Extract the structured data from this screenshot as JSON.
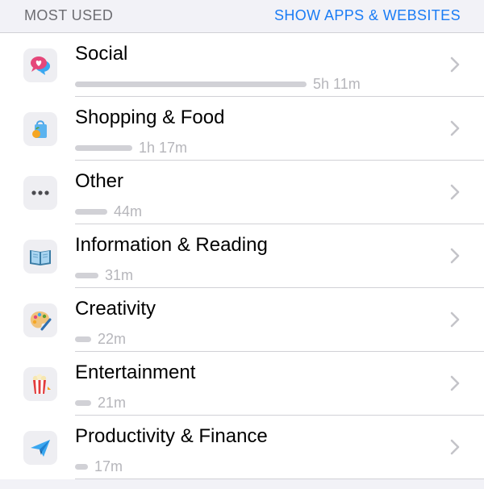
{
  "header": {
    "title": "MOST USED",
    "action": "SHOW APPS & WEBSITES"
  },
  "categories": [
    {
      "name": "Social",
      "time": "5h 11m",
      "usage_fraction": 1.0,
      "icon": "social-speech-bubble-heart-icon"
    },
    {
      "name": "Shopping & Food",
      "time": "1h 17m",
      "usage_fraction": 0.248,
      "icon": "shopping-bag-icon"
    },
    {
      "name": "Other",
      "time": "44m",
      "usage_fraction": 0.141,
      "icon": "more-dots-icon"
    },
    {
      "name": "Information & Reading",
      "time": "31m",
      "usage_fraction": 0.1,
      "icon": "open-book-icon"
    },
    {
      "name": "Creativity",
      "time": "22m",
      "usage_fraction": 0.071,
      "icon": "paint-palette-icon"
    },
    {
      "name": "Entertainment",
      "time": "21m",
      "usage_fraction": 0.068,
      "icon": "popcorn-icon"
    },
    {
      "name": "Productivity & Finance",
      "time": "17m",
      "usage_fraction": 0.055,
      "icon": "paper-plane-icon"
    }
  ],
  "colors": {
    "accent": "#1a7cf5",
    "bar": "#d1d1d6",
    "secondary_text": "#b6b6bb",
    "header_text": "#6d6d72"
  }
}
